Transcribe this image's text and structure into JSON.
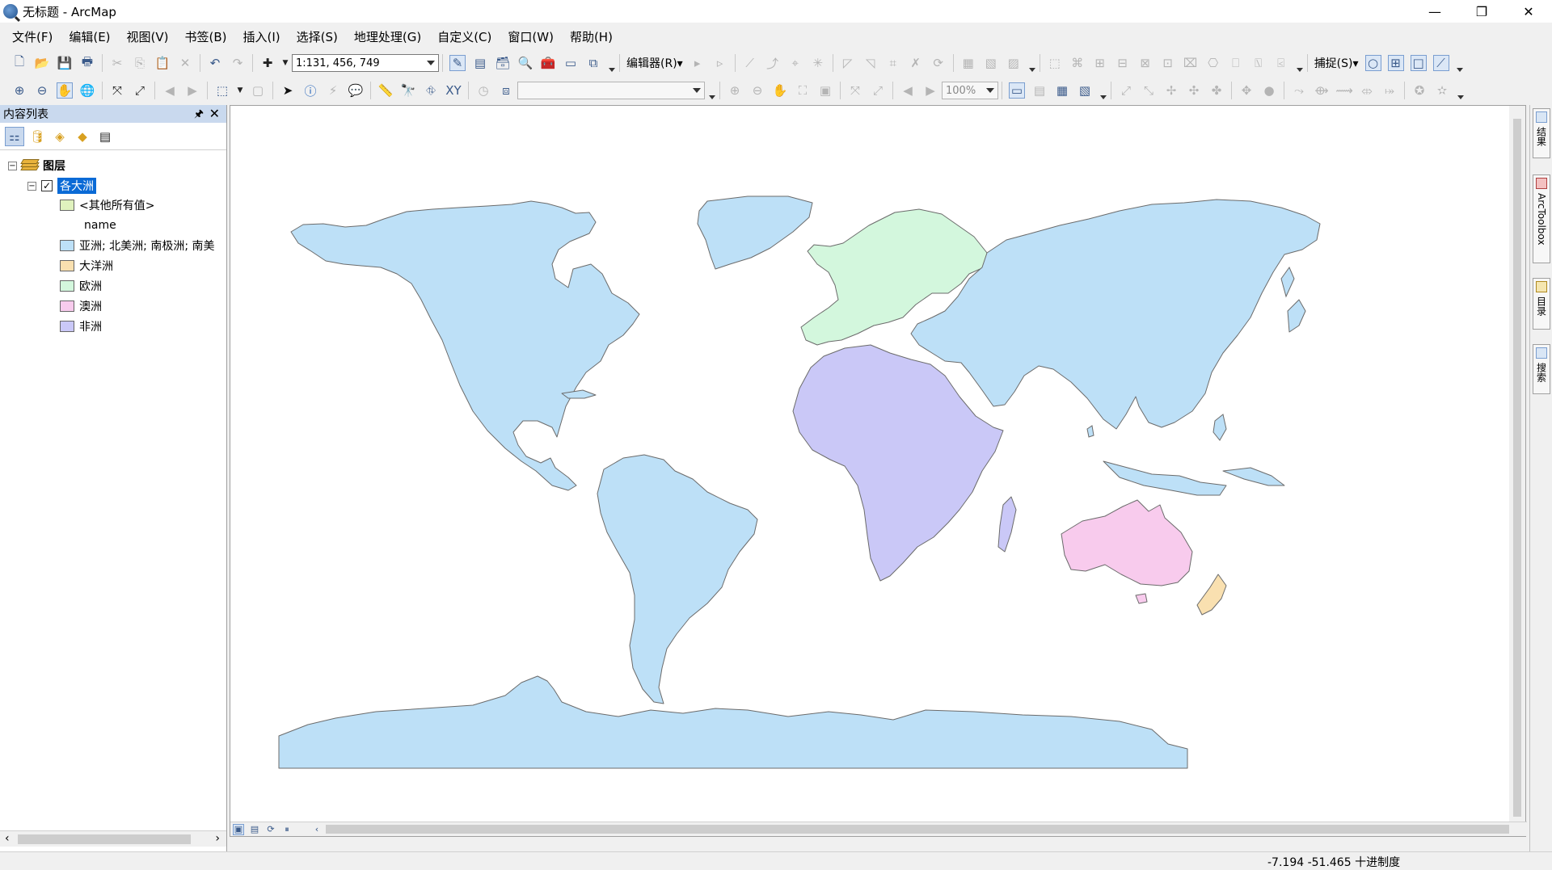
{
  "window": {
    "title": "无标题 - ArcMap"
  },
  "menu": [
    "文件(F)",
    "编辑(E)",
    "视图(V)",
    "书签(B)",
    "插入(I)",
    "选择(S)",
    "地理处理(G)",
    "自定义(C)",
    "窗口(W)",
    "帮助(H)"
  ],
  "toolbar": {
    "scale": "1:131, 456, 749",
    "editor_label": "编辑器(R)▾",
    "snapping_label": "捕捉(S)▾",
    "zoom_percent": "100%"
  },
  "toc": {
    "title": "内容列表",
    "group_label": "图层",
    "layer_label": "各大洲",
    "legend_other": "<其他所有值>",
    "legend_field": "name",
    "legend_items": [
      {
        "label": "亚洲; 北美洲; 南极洲; 南美",
        "color": "#bde0f7"
      },
      {
        "label": "大洋洲",
        "color": "#f9e0b0"
      },
      {
        "label": "欧洲",
        "color": "#d3f7dd"
      },
      {
        "label": "澳洲",
        "color": "#f8cbed"
      },
      {
        "label": "非洲",
        "color": "#cac8f7"
      }
    ],
    "other_color": "#e0f2be"
  },
  "dock_tabs": [
    "结果",
    "ArcToolbox",
    "目录",
    "搜索"
  ],
  "status": {
    "coordinates": "-7.194  -51.465 十进制度"
  },
  "map": {
    "continents": [
      {
        "name": "北美洲",
        "color": "#bde0f7"
      },
      {
        "name": "南美洲",
        "color": "#bde0f7"
      },
      {
        "name": "亚洲",
        "color": "#bde0f7"
      },
      {
        "name": "南极洲",
        "color": "#bde0f7"
      },
      {
        "name": "欧洲",
        "color": "#d3f7dd"
      },
      {
        "name": "非洲",
        "color": "#cac8f7"
      },
      {
        "name": "澳洲",
        "color": "#f8cbed"
      },
      {
        "name": "大洋洲",
        "color": "#f9e0b0"
      }
    ]
  }
}
